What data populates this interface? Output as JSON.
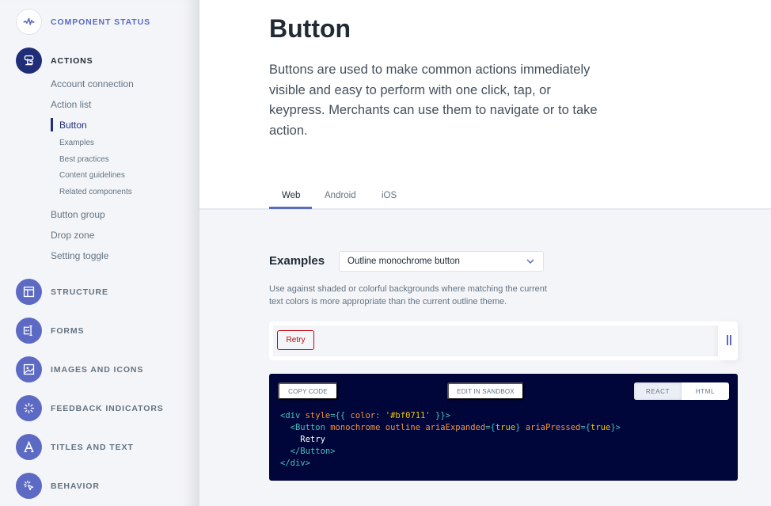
{
  "sidebar": {
    "status": {
      "label": "Component status",
      "icon": "activity-icon"
    },
    "actions": {
      "label": "Actions",
      "icon": "actions-icon",
      "items": [
        {
          "label": "Account connection"
        },
        {
          "label": "Action list"
        },
        {
          "label": "Button",
          "current": true,
          "subitems": [
            "Examples",
            "Best practices",
            "Content guidelines",
            "Related components"
          ]
        },
        {
          "label": "Button group"
        },
        {
          "label": "Drop zone"
        },
        {
          "label": "Setting toggle"
        }
      ]
    },
    "sections": [
      {
        "label": "Structure",
        "icon": "layout-icon"
      },
      {
        "label": "Forms",
        "icon": "text-field-icon"
      },
      {
        "label": "Images and icons",
        "icon": "image-icon"
      },
      {
        "label": "Feedback indicators",
        "icon": "spinner-icon"
      },
      {
        "label": "Titles and text",
        "icon": "typography-icon"
      },
      {
        "label": "Behavior",
        "icon": "pointer-icon"
      }
    ]
  },
  "page": {
    "title": "Button",
    "lead": "Buttons are used to make common actions immediately visible and easy to perform with one click, tap, or keypress. Merchants can use them to navigate or to take action.",
    "tabs": [
      "Web",
      "Android",
      "iOS"
    ],
    "active_tab": "Web"
  },
  "examples": {
    "label": "Examples",
    "selected": "Outline monochrome button",
    "description": "Use against shaded or colorful backgrounds where matching the current text colors is more appropriate than the current outline theme.",
    "preview_button": "Retry",
    "preview_color": "#bf0711"
  },
  "code": {
    "copy_label": "COPY CODE",
    "sandbox_label": "EDIT IN SANDBOX",
    "toggle": [
      "REACT",
      "HTML"
    ],
    "toggle_active": "REACT",
    "lines": [
      [
        [
          "tag",
          "<div "
        ],
        [
          "attr",
          "style"
        ],
        [
          "tag",
          "={{ "
        ],
        [
          "attr",
          "color"
        ],
        [
          "tag",
          ": "
        ],
        [
          "str",
          "'#bf0711'"
        ],
        [
          "tag",
          " }}>"
        ]
      ],
      [
        [
          "txt",
          "  "
        ],
        [
          "tag",
          "<Button "
        ],
        [
          "attr",
          "monochrome outline ariaExpanded"
        ],
        [
          "tag",
          "={"
        ],
        [
          "kw",
          "true"
        ],
        [
          "tag",
          "} "
        ],
        [
          "attr",
          "ariaPressed"
        ],
        [
          "tag",
          "={"
        ],
        [
          "kw",
          "true"
        ],
        [
          "tag",
          "}>"
        ]
      ],
      [
        [
          "txt",
          "    Retry"
        ]
      ],
      [
        [
          "txt",
          "  "
        ],
        [
          "tag",
          "</Button>"
        ]
      ],
      [
        [
          "tag",
          "</div>"
        ]
      ]
    ]
  },
  "colors": {
    "accent": "#5c6ac4",
    "accent_dark": "#202e78",
    "code_bg": "#000639",
    "critical": "#bf0711"
  }
}
